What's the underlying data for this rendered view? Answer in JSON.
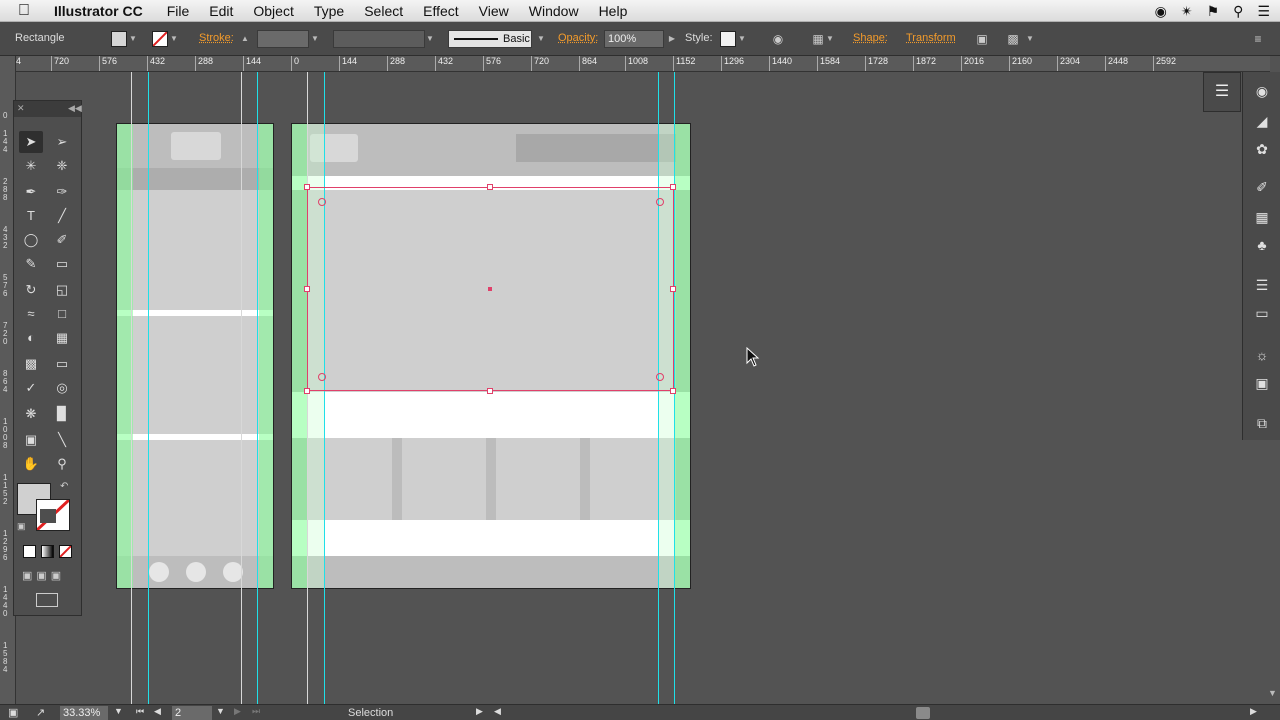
{
  "menubar": {
    "app_name": "Illustrator CC",
    "items": [
      "File",
      "Edit",
      "Object",
      "Type",
      "Select",
      "Effect",
      "View",
      "Window",
      "Help"
    ]
  },
  "controlbar": {
    "selection_type": "Rectangle",
    "stroke_label": "Stroke:",
    "stroke_profile": "Basic",
    "opacity_label": "Opacity:",
    "opacity_value": "100%",
    "style_label": "Style:",
    "shape_label": "Shape:",
    "transform_label": "Transform"
  },
  "ruler": {
    "h_ticks": [
      "4",
      "720",
      "576",
      "432",
      "288",
      "144",
      "0",
      "144",
      "288",
      "432",
      "576",
      "720",
      "864",
      "1008",
      "1152",
      "1296",
      "1440",
      "1584",
      "1728",
      "1872",
      "2016",
      "2160",
      "2304",
      "2448",
      "2592"
    ],
    "v_ticks": [
      "0",
      "1\n4\n4",
      "2\n8\n8",
      "4\n3\n2",
      "5\n7\n6",
      "7\n2\n0",
      "8\n6\n4",
      "1\n0\n0\n8",
      "1\n1\n5\n2",
      "1\n2\n9\n6",
      "1\n4\n4\n0",
      "1\n5\n8\n4"
    ]
  },
  "statusbar": {
    "zoom": "33.33%",
    "page": "2",
    "mode": "Selection"
  },
  "colors": {
    "selection": "#e0406a",
    "guide": "#1fe0e8",
    "bleed": "#7dff91"
  }
}
